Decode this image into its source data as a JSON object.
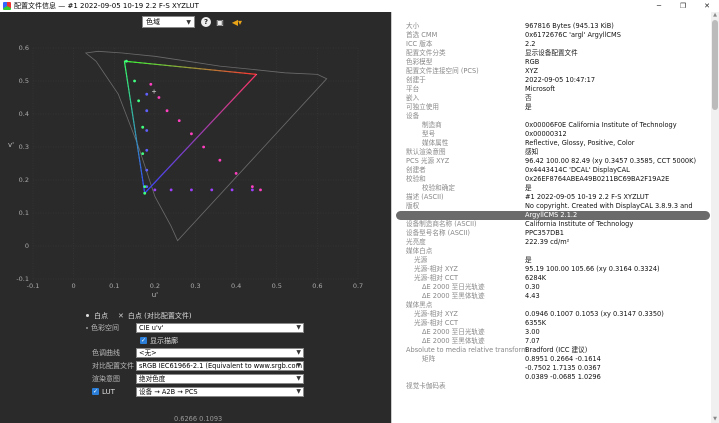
{
  "window": {
    "title": "配置文件信息 — #1 2022-09-05 10-19 2.2 F-S XYZLUT",
    "minimize": "─",
    "maximize": "❐",
    "close": "✕"
  },
  "toolbar": {
    "gamut_select": "色域",
    "help_icon": "question-circle-icon",
    "image_icon": "image-icon",
    "sound_icon": "speaker-icon"
  },
  "plot": {
    "y_axis_label": "v'",
    "x_axis_label": "u'",
    "x_ticks": [
      "-0.1",
      "0",
      "0.1",
      "0.2",
      "0.3",
      "0.4",
      "0.5",
      "0.6",
      "0.7"
    ],
    "y_ticks": [
      "0.6",
      "0.5",
      "0.4",
      "0.3",
      "0.2",
      "0.1",
      "0",
      "-0.1"
    ],
    "colors": {
      "grid": "#3a3a3a",
      "locus": "#6b6b6b",
      "triangle": "#ffffff"
    }
  },
  "chart_data": {
    "type": "scatter",
    "xlabel": "u'",
    "ylabel": "v'",
    "xlim": [
      -0.1,
      0.7
    ],
    "ylim": [
      -0.1,
      0.6
    ],
    "series": [
      {
        "values": [
          [
            0.19,
            0.49
          ],
          [
            0.21,
            0.45
          ],
          [
            0.23,
            0.41
          ],
          [
            0.26,
            0.38
          ],
          [
            0.29,
            0.34
          ],
          [
            0.32,
            0.3
          ],
          [
            0.36,
            0.26
          ],
          [
            0.4,
            0.22
          ],
          [
            0.44,
            0.18
          ],
          [
            0.46,
            0.17
          ]
        ]
      },
      {
        "values": [
          [
            0.18,
            0.18
          ],
          [
            0.18,
            0.23
          ],
          [
            0.18,
            0.29
          ],
          [
            0.18,
            0.35
          ],
          [
            0.18,
            0.41
          ],
          [
            0.18,
            0.46
          ]
        ]
      },
      {
        "values": [
          [
            0.2,
            0.17
          ],
          [
            0.24,
            0.17
          ],
          [
            0.29,
            0.17
          ],
          [
            0.34,
            0.17
          ],
          [
            0.39,
            0.17
          ],
          [
            0.44,
            0.17
          ]
        ]
      },
      {
        "values": [
          [
            0.13,
            0.56
          ],
          [
            0.15,
            0.5
          ],
          [
            0.16,
            0.44
          ],
          [
            0.17,
            0.36
          ],
          [
            0.17,
            0.28
          ],
          [
            0.175,
            0.18
          ],
          [
            0.175,
            0.16
          ]
        ]
      }
    ],
    "triangle": {
      "values": [
        [
          0.125,
          0.56
        ],
        [
          0.45,
          0.52
        ],
        [
          0.175,
          0.16
        ]
      ]
    },
    "white_point": [
      0.198,
      0.468
    ],
    "grid": true
  },
  "controls": {
    "white_point_label": "白点",
    "white_point_compare_label": "白点 (对比配置文件)",
    "colorspace_label": "色彩空间",
    "colorspace_value": "CIE u'v'",
    "show_outline_label": "显示描廓",
    "tone_curve_label": "色调曲线",
    "tone_curve_value": "<无>",
    "compare_profile_label": "对比配置文件",
    "compare_profile_value": "sRGB IEC61966-2.1 (Equivalent to www.srgb.com",
    "intent_label": "渲染意图",
    "intent_value": "绝对色度",
    "lut_label": "LUT",
    "lut_value": "设备 → A2B → PCS",
    "coords": "0.6266 0.1093"
  },
  "info": [
    {
      "k": "大小",
      "v": "967816 Bytes (945.13 KiB)",
      "indent": 0
    },
    {
      "k": "首选 CMM",
      "v": "0x6172676C 'argl' ArgyllCMS",
      "indent": 0
    },
    {
      "k": "ICC 版本",
      "v": "2.2",
      "indent": 0
    },
    {
      "k": "配置文件分类",
      "v": "显示设备配置文件",
      "indent": 0
    },
    {
      "k": "色彩模型",
      "v": "RGB",
      "indent": 0
    },
    {
      "k": "配置文件连接空间 (PCS)",
      "v": "XYZ",
      "indent": 0
    },
    {
      "k": "创建于",
      "v": "2022-09-05 10:47:17",
      "indent": 0
    },
    {
      "k": "平台",
      "v": "Microsoft",
      "indent": 0
    },
    {
      "k": "嵌入",
      "v": "否",
      "indent": 0
    },
    {
      "k": "可独立使用",
      "v": "是",
      "indent": 0
    },
    {
      "k": "设备",
      "v": "",
      "indent": 0
    },
    {
      "k": "制造商",
      "v": "0x00006F0E California Institute of Technology",
      "indent": 2
    },
    {
      "k": "型号",
      "v": "0x00000312",
      "indent": 2
    },
    {
      "k": "媒体属性",
      "v": "Reflective, Glossy, Positive, Color",
      "indent": 2
    },
    {
      "k": "默认渲染意图",
      "v": "感知",
      "indent": 0
    },
    {
      "k": "PCS 光源 XYZ",
      "v": "96.42 100.00  82.49 (xy 0.3457 0.3585, CCT 5000K)",
      "indent": 0
    },
    {
      "k": "创建者",
      "v": "0x4443414C 'DCAL' DisplayCAL",
      "indent": 0
    },
    {
      "k": "校验和",
      "v": "0x26EF8764ABEA49B0211BC69BA2F19A2E",
      "indent": 0
    },
    {
      "k": "校验和确定",
      "v": "是",
      "indent": 2
    },
    {
      "k": "描述 (ASCII)",
      "v": "#1 2022-09-05 10-19 2.2 F-S XYZLUT",
      "indent": 0
    },
    {
      "k": "版权",
      "v": "No copyright. Created with DisplayCAL 3.8.9.3 and",
      "indent": 0
    },
    {
      "k": "",
      "v": "ArgyllCMS 2.1.2",
      "indent": 0,
      "selected": true
    },
    {
      "k": "设备制造商名称 (ASCII)",
      "v": "California Institute of Technology",
      "indent": 0
    },
    {
      "k": "设备型号名称 (ASCII)",
      "v": "PPC357DB1",
      "indent": 0
    },
    {
      "k": "光亮度",
      "v": "222.39 cd/m²",
      "indent": 0
    },
    {
      "k": "媒体白点",
      "v": "",
      "indent": 0
    },
    {
      "k": "光源",
      "v": "是",
      "indent": 1
    },
    {
      "k": "光源-相对 XYZ",
      "v": "95.19 100.00 105.66 (xy 0.3164 0.3324)",
      "indent": 1
    },
    {
      "k": "光源-相对 CCT",
      "v": "6284K",
      "indent": 1
    },
    {
      "k": "ΔE 2000 至日光轨迹",
      "v": "0.30",
      "indent": 2
    },
    {
      "k": "ΔE 2000 至黑体轨迹",
      "v": "4.43",
      "indent": 2
    },
    {
      "k": "媒体黑点",
      "v": "",
      "indent": 0
    },
    {
      "k": "光源-相对 XYZ",
      "v": "0.0946 0.1007 0.1053 (xy 0.3147 0.3350)",
      "indent": 1
    },
    {
      "k": "光源-相对 CCT",
      "v": "6355K",
      "indent": 1
    },
    {
      "k": "ΔE 2000 至日光轨迹",
      "v": "3.00",
      "indent": 2
    },
    {
      "k": "ΔE 2000 至黑体轨迹",
      "v": "7.07",
      "indent": 2
    },
    {
      "k": "Absolute to media relative transform",
      "v": "Bradford (ICC 建议)",
      "indent": 0
    },
    {
      "k": "矩阵",
      "v": "0.8951  0.2664  -0.1614",
      "indent": 2
    },
    {
      "k": "",
      "v": "-0.7502  1.7135  0.0367",
      "indent": 0
    },
    {
      "k": "",
      "v": "0.0389  -0.0685  1.0296",
      "indent": 0
    },
    {
      "k": "视觉卡伽码表",
      "v": "",
      "indent": 0
    }
  ]
}
